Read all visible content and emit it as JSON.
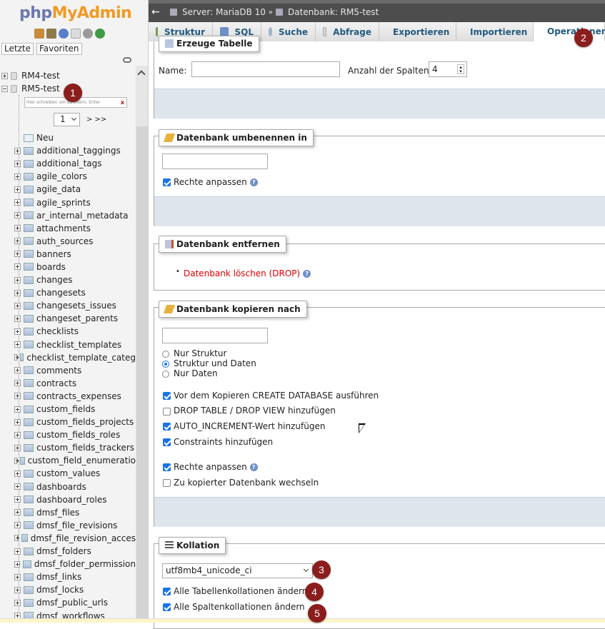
{
  "nav": {
    "logo_php": "php",
    "logo_myadmin": "MyAdmin",
    "tabs": [
      "Letzte",
      "Favoriten"
    ],
    "databases": [
      "RM4-test",
      "RM5-test"
    ],
    "filter_placeholder": "Hier schreiben um zu filtern, Enter",
    "filter_clear": "x",
    "pager_value": "1",
    "pager_next": "> >>",
    "new_label": "Neu",
    "tables": [
      "additional_taggings",
      "additional_tags",
      "agile_colors",
      "agile_data",
      "agile_sprints",
      "ar_internal_metadata",
      "attachments",
      "auth_sources",
      "banners",
      "boards",
      "changes",
      "changesets",
      "changesets_issues",
      "changeset_parents",
      "checklists",
      "checklist_templates",
      "checklist_template_categ",
      "comments",
      "contracts",
      "contracts_expenses",
      "custom_fields",
      "custom_fields_projects",
      "custom_fields_roles",
      "custom_fields_trackers",
      "custom_field_enumeratio",
      "custom_values",
      "dashboards",
      "dashboard_roles",
      "dmsf_files",
      "dmsf_file_revisions",
      "dmsf_file_revision_acces",
      "dmsf_folders",
      "dmsf_folder_permission",
      "dmsf_links",
      "dmsf_locks",
      "dmsf_public_urls",
      "dmsf_workflows"
    ]
  },
  "breadcrumb": {
    "server": "Server: MariaDB 10",
    "separator": "»",
    "database": "Datenbank: RM5-test"
  },
  "tabs": [
    "Struktur",
    "SQL",
    "Suche",
    "Abfrage",
    "Exportieren",
    "Importieren",
    "Operationen"
  ],
  "create_table": {
    "legend": "Erzeuge Tabelle",
    "name_label": "Name:",
    "columns_label": "Anzahl der Spalten:",
    "columns_value": "4"
  },
  "rename_db": {
    "legend": "Datenbank umbenennen in",
    "adjust_privileges": "Rechte anpassen"
  },
  "drop_db": {
    "legend": "Datenbank entfernen",
    "link": "Datenbank löschen (DROP)"
  },
  "copy_db": {
    "legend": "Datenbank kopieren nach",
    "radio_options": [
      "Nur Struktur",
      "Struktur und Daten",
      "Nur Daten"
    ],
    "checkbox_options": [
      "Vor dem Kopieren CREATE DATABASE ausführen",
      "DROP TABLE / DROP VIEW hinzufügen",
      "AUTO_INCREMENT-Wert hinzufügen",
      "Constraints hinzufügen"
    ],
    "adjust_privileges": "Rechte anpassen",
    "switch_db": "Zu kopierter Datenbank wechseln"
  },
  "collation": {
    "legend": "Kollation",
    "value": "utf8mb4_unicode_ci",
    "change_tables": "Alle Tabellenkollationen ändern",
    "change_columns": "Alle Spaltenkollationen ändern"
  },
  "markers": [
    "1",
    "2",
    "3",
    "4",
    "5"
  ],
  "help_glyph": "?",
  "colors": {
    "accent_link": "#235a81",
    "danger_link": "#e00000",
    "marker": "#8b1d1d",
    "checkbox": "#1a73e8"
  }
}
